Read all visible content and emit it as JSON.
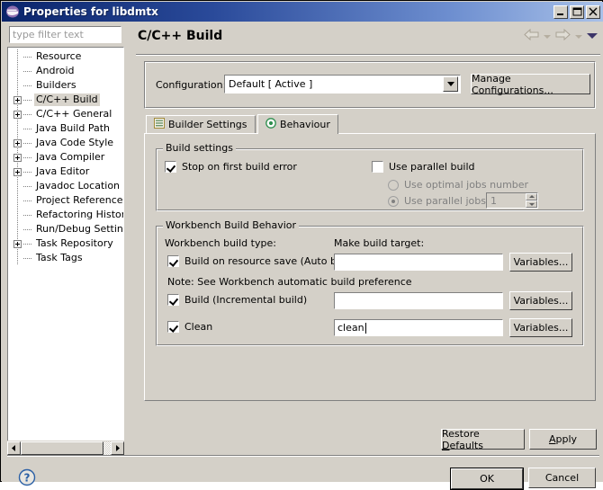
{
  "window": {
    "title": "Properties for libdmtx",
    "icon": "eclipse-icon",
    "minimize_label": "Minimize",
    "maximize_label": "Maximize",
    "close_label": "Close"
  },
  "sidebar": {
    "filter": {
      "placeholder": "type filter text",
      "value": ""
    },
    "items": [
      {
        "label": "Resource",
        "expandable": false,
        "selected": false
      },
      {
        "label": "Android",
        "expandable": false,
        "selected": false
      },
      {
        "label": "Builders",
        "expandable": false,
        "selected": false
      },
      {
        "label": "C/C++ Build",
        "expandable": true,
        "selected": true
      },
      {
        "label": "C/C++ General",
        "expandable": true,
        "selected": false
      },
      {
        "label": "Java Build Path",
        "expandable": false,
        "selected": false
      },
      {
        "label": "Java Code Style",
        "expandable": true,
        "selected": false
      },
      {
        "label": "Java Compiler",
        "expandable": true,
        "selected": false
      },
      {
        "label": "Java Editor",
        "expandable": true,
        "selected": false
      },
      {
        "label": "Javadoc Location",
        "expandable": false,
        "selected": false
      },
      {
        "label": "Project References",
        "expandable": false,
        "selected": false
      },
      {
        "label": "Refactoring History",
        "expandable": false,
        "selected": false
      },
      {
        "label": "Run/Debug Settings",
        "expandable": false,
        "selected": false
      },
      {
        "label": "Task Repository",
        "expandable": true,
        "selected": false
      },
      {
        "label": "Task Tags",
        "expandable": false,
        "selected": false
      }
    ]
  },
  "page": {
    "title": "C/C++ Build",
    "nav": {
      "back": "back-arrow",
      "back_menu": "back-dropdown",
      "forward": "forward-arrow",
      "forward_menu": "forward-dropdown",
      "menu": "view-menu"
    }
  },
  "configuration": {
    "label": "Configuration:",
    "value": "Default  [ Active ]",
    "manage_button": "Manage Configurations..."
  },
  "tabs": [
    {
      "label": "Builder Settings",
      "icon": "document-lines-icon",
      "active": false
    },
    {
      "label": "Behaviour",
      "icon": "target-circle-icon",
      "active": true
    }
  ],
  "build_settings": {
    "legend": "Build settings",
    "stop_on_first_error": {
      "label": "Stop on first build error",
      "checked": true,
      "enabled": true
    },
    "use_parallel_build": {
      "label": "Use parallel build",
      "checked": false,
      "enabled": true
    },
    "use_optimal_jobs": {
      "label": "Use optimal jobs number",
      "selected": false,
      "enabled": false
    },
    "use_parallel_jobs": {
      "label": "Use parallel jobs:",
      "selected": true,
      "enabled": false
    },
    "jobs_value": "1"
  },
  "workbench_build": {
    "legend": "Workbench Build Behavior",
    "build_type_label": "Workbench build type:",
    "make_target_label": "Make build target:",
    "note": "Note: See Workbench automatic build preference",
    "rows": [
      {
        "label": "Build on resource save (Auto build)",
        "checked": true,
        "value": "",
        "button": "Variables..."
      },
      {
        "label": "Build (Incremental build)",
        "checked": true,
        "value": "",
        "button": "Variables..."
      },
      {
        "label": "Clean",
        "checked": true,
        "value": "clean",
        "button": "Variables...",
        "focused": true
      }
    ]
  },
  "footer": {
    "restore_defaults": "Restore Defaults",
    "restore_defaults_mnemonic": "D",
    "apply": "Apply",
    "apply_mnemonic": "A",
    "help": "help-icon",
    "ok": "OK",
    "cancel": "Cancel"
  },
  "colors": {
    "face": "#d4d0c8",
    "title_start": "#0a246a",
    "title_end": "#a8c0e8",
    "field_bg": "#ffffff",
    "selection": "#d8d4cc",
    "disabled_text": "#808080",
    "tab_icon_green": "#2f8f4f",
    "help_blue": "#2a5fa5"
  }
}
